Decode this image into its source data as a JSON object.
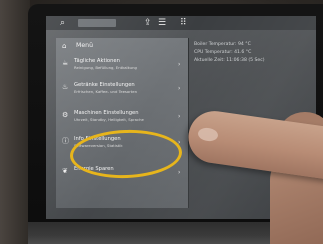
{
  "device": {
    "menu_title": "Menü",
    "menu_items": [
      {
        "title": "Tägliche Aktionen",
        "subtitle": "Reinigung, Befüllung, Entkalkung",
        "icon": "coffee-cup-icon"
      },
      {
        "title": "Getränke Einstellungen",
        "subtitle": "Erfrischen, Kaffee- und Teesorten",
        "icon": "cup-icon"
      },
      {
        "title": "Maschinen Einstellungen",
        "subtitle": "Uhrzeit, Standby, Helligkeit, Sprache",
        "icon": "gear-icon"
      },
      {
        "title": "Info Einstellungen",
        "subtitle": "Softwareversion, Statistik",
        "icon": "info-icon"
      },
      {
        "title": "Energie Sparen",
        "subtitle": "",
        "icon": "leaf-icon"
      }
    ],
    "status_lines": [
      "Boiler Temperatur: 94 °C",
      "CPU Temperatur: 41.6 °C",
      "Aktuelle Zeit: 11:06:38 (5 Sec)"
    ],
    "top_icons": [
      "search-icon",
      "usb-icon",
      "list-icon",
      "grid-icon"
    ]
  },
  "colors": {
    "highlight": "#e7b51c",
    "screen": "#4a4d50",
    "menu": "#787c80"
  }
}
